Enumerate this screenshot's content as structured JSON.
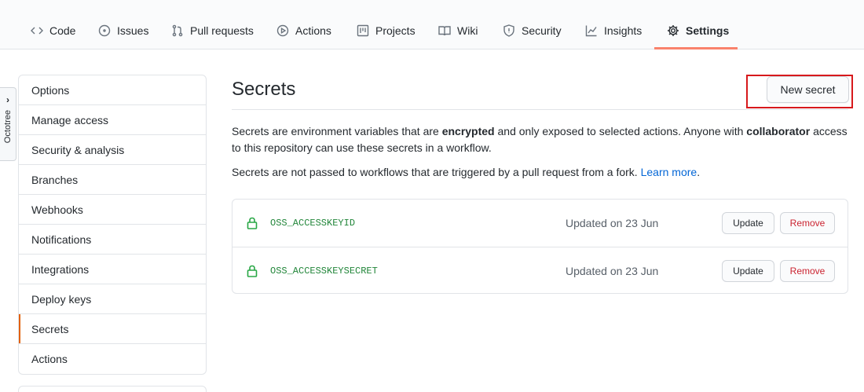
{
  "nav": {
    "tabs": [
      {
        "label": "Code",
        "icon": "code-icon"
      },
      {
        "label": "Issues",
        "icon": "issue-icon"
      },
      {
        "label": "Pull requests",
        "icon": "pull-request-icon"
      },
      {
        "label": "Actions",
        "icon": "play-icon"
      },
      {
        "label": "Projects",
        "icon": "project-icon"
      },
      {
        "label": "Wiki",
        "icon": "book-icon"
      },
      {
        "label": "Security",
        "icon": "shield-icon"
      },
      {
        "label": "Insights",
        "icon": "graph-icon"
      },
      {
        "label": "Settings",
        "icon": "gear-icon"
      }
    ],
    "selected": "Settings",
    "accent_color": "#f9826c"
  },
  "octotree": {
    "label": "Octotree",
    "chevron": "›"
  },
  "sidebar": {
    "items": [
      {
        "label": "Options"
      },
      {
        "label": "Manage access"
      },
      {
        "label": "Security & analysis"
      },
      {
        "label": "Branches"
      },
      {
        "label": "Webhooks"
      },
      {
        "label": "Notifications"
      },
      {
        "label": "Integrations"
      },
      {
        "label": "Deploy keys"
      },
      {
        "label": "Secrets"
      },
      {
        "label": "Actions"
      }
    ],
    "selected": "Secrets"
  },
  "main": {
    "title": "Secrets",
    "new_secret_label": "New secret",
    "desc": {
      "p1_a": "Secrets are environment variables that are ",
      "p1_b": "encrypted",
      "p1_c": " and only exposed to selected actions. Anyone with ",
      "p1_d": "collaborator",
      "p1_e": " access to this repository can use these secrets in a workflow.",
      "p2_a": "Secrets are not passed to workflows that are triggered by a pull request from a fork. ",
      "learn_more": "Learn more",
      "p2_end": "."
    },
    "secrets": [
      {
        "name": "OSS_ACCESSKEYID",
        "updated": "Updated on 23 Jun",
        "update_label": "Update",
        "remove_label": "Remove"
      },
      {
        "name": "OSS_ACCESSKEYSECRET",
        "updated": "Updated on 23 Jun",
        "update_label": "Update",
        "remove_label": "Remove"
      }
    ]
  },
  "colors": {
    "highlight_box": "#d7191c",
    "secret_name": "#22863a",
    "remove_text": "#cb2431",
    "link": "#0366d6"
  }
}
